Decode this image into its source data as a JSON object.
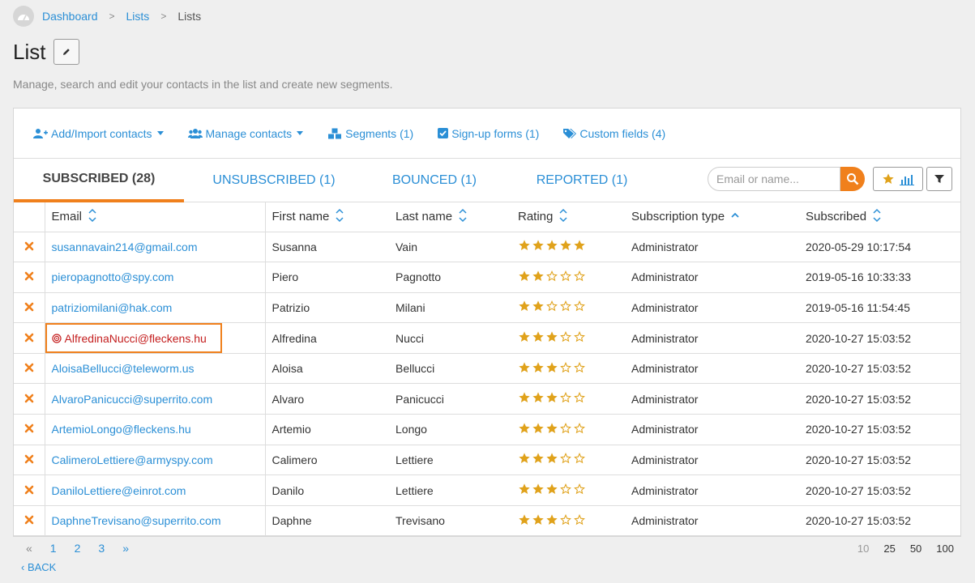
{
  "breadcrumb": {
    "items": [
      "Dashboard",
      "Lists"
    ],
    "current": "Lists"
  },
  "page": {
    "title": "List",
    "subtitle": "Manage, search and edit your contacts in the list and create new segments."
  },
  "toolbar": {
    "add_import": "Add/Import contacts",
    "manage": "Manage contacts",
    "segments": "Segments (1)",
    "signup": "Sign-up forms (1)",
    "custom_fields": "Custom fields (4)"
  },
  "tabs": {
    "subscribed": "SUBSCRIBED (28)",
    "unsubscribed": "UNSUBSCRIBED (1)",
    "bounced": "BOUNCED (1)",
    "reported": "REPORTED (1)"
  },
  "search": {
    "placeholder": "Email or name..."
  },
  "columns": {
    "email": "Email",
    "first_name": "First name",
    "last_name": "Last name",
    "rating": "Rating",
    "subscription_type": "Subscription type",
    "subscribed": "Subscribed"
  },
  "rows": [
    {
      "email": "susannavain214@gmail.com",
      "first": "Susanna",
      "last": "Vain",
      "rating": 5,
      "type": "Administrator",
      "subscribed": "2020-05-29 10:17:54"
    },
    {
      "email": "pieropagnotto@spy.com",
      "first": "Piero",
      "last": "Pagnotto",
      "rating": 2,
      "type": "Administrator",
      "subscribed": "2019-05-16 10:33:33"
    },
    {
      "email": "patriziomilani@hak.com",
      "first": "Patrizio",
      "last": "Milani",
      "rating": 2,
      "type": "Administrator",
      "subscribed": "2019-05-16 11:54:45"
    },
    {
      "email": "AlfredinaNucci@fleckens.hu",
      "first": "Alfredina",
      "last": "Nucci",
      "rating": 3,
      "type": "Administrator",
      "subscribed": "2020-10-27 15:03:52",
      "highlighted": true
    },
    {
      "email": "AloisaBellucci@teleworm.us",
      "first": "Aloisa",
      "last": "Bellucci",
      "rating": 3,
      "type": "Administrator",
      "subscribed": "2020-10-27 15:03:52"
    },
    {
      "email": "AlvaroPanicucci@superrito.com",
      "first": "Alvaro",
      "last": "Panicucci",
      "rating": 3,
      "type": "Administrator",
      "subscribed": "2020-10-27 15:03:52"
    },
    {
      "email": "ArtemioLongo@fleckens.hu",
      "first": "Artemio",
      "last": "Longo",
      "rating": 3,
      "type": "Administrator",
      "subscribed": "2020-10-27 15:03:52"
    },
    {
      "email": "CalimeroLettiere@armyspy.com",
      "first": "Calimero",
      "last": "Lettiere",
      "rating": 3,
      "type": "Administrator",
      "subscribed": "2020-10-27 15:03:52"
    },
    {
      "email": "DaniloLettiere@einrot.com",
      "first": "Danilo",
      "last": "Lettiere",
      "rating": 3,
      "type": "Administrator",
      "subscribed": "2020-10-27 15:03:52"
    },
    {
      "email": "DaphneTrevisano@superrito.com",
      "first": "Daphne",
      "last": "Trevisano",
      "rating": 3,
      "type": "Administrator",
      "subscribed": "2020-10-27 15:03:52"
    }
  ],
  "pagination": {
    "prev": "«",
    "pages": [
      "1",
      "2",
      "3"
    ],
    "next": "»"
  },
  "per_page": [
    "10",
    "25",
    "50",
    "100"
  ],
  "back": "‹ BACK",
  "colors": {
    "accent": "#f0801c",
    "link": "#2b8fd6",
    "star": "#e0a21b",
    "delete": "#f0801c",
    "highlight_text": "#c41e1e"
  }
}
